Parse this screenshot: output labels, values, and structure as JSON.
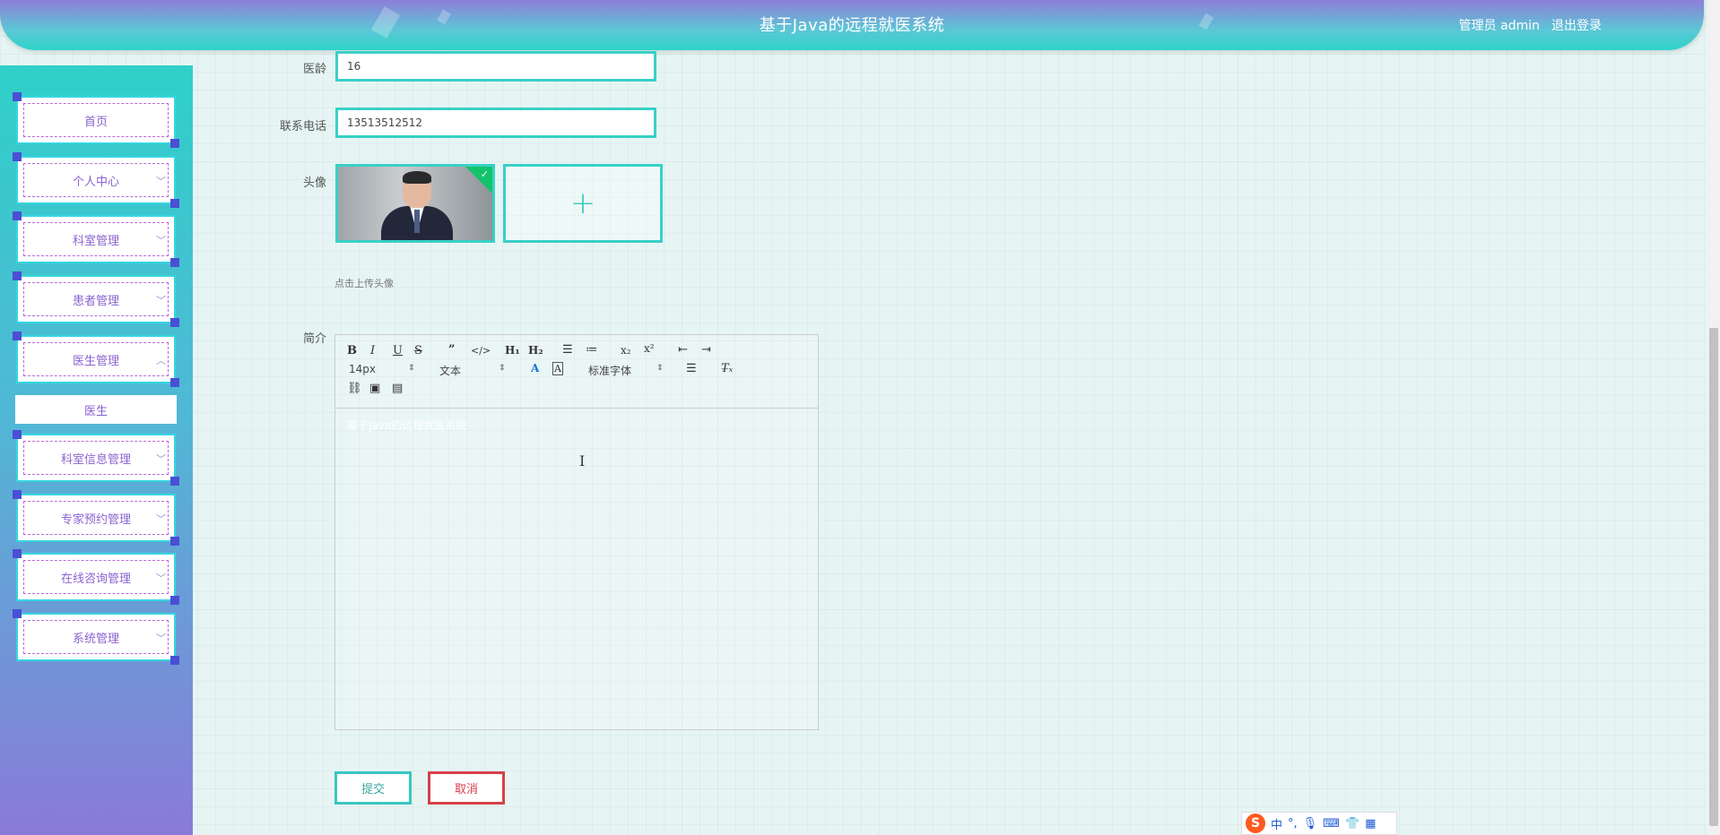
{
  "header": {
    "title": "基于Java的远程就医系统",
    "user": "管理员 admin",
    "logout": "退出登录"
  },
  "sidebar": {
    "items": [
      {
        "label": "首页"
      },
      {
        "label": "个人中心"
      },
      {
        "label": "科室管理"
      },
      {
        "label": "患者管理"
      },
      {
        "label": "医生管理"
      },
      {
        "label": "科室信息管理"
      },
      {
        "label": "专家预约管理"
      },
      {
        "label": "在线咨询管理"
      },
      {
        "label": "系统管理"
      }
    ],
    "submenu": {
      "label": "医生"
    }
  },
  "form": {
    "age_label": "医龄",
    "age_value": "16",
    "phone_label": "联系电话",
    "phone_value": "13513512512",
    "avatar_label": "头像",
    "upload_hint": "点击上传头像",
    "intro_label": "简介",
    "editor": {
      "font_size": "14px",
      "paragraph": "文本",
      "font_family": "标准字体",
      "content": "基于Java的远程就医系统"
    },
    "submit_label": "提交",
    "cancel_label": "取消"
  },
  "ime": {
    "mode": "中"
  },
  "colors": {
    "accent": "#39d0c6",
    "menu_text": "#8b63d0",
    "cancel": "#d9404b"
  }
}
